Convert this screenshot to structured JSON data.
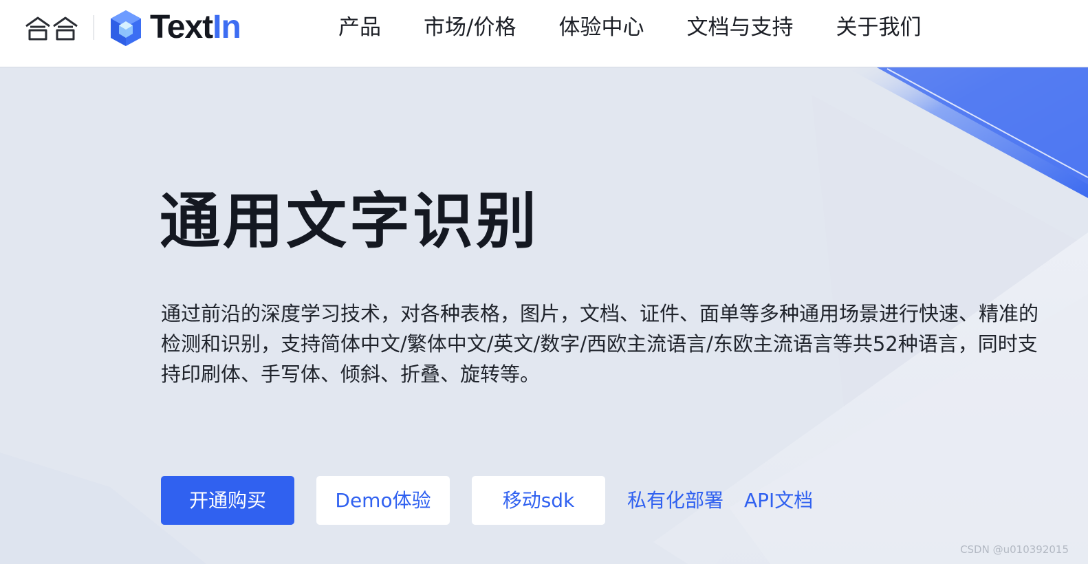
{
  "header": {
    "brand_hehe": "合合",
    "textin_text": "Text",
    "textin_in": "In",
    "nav": [
      "产品",
      "市场/价格",
      "体验中心",
      "文档与支持",
      "关于我们"
    ]
  },
  "hero": {
    "title": "通用文字识别",
    "description": "通过前沿的深度学习技术，对各种表格，图片，文档、证件、面单等多种通用场景进行快速、精准的检测和识别，支持简体中文/繁体中文/英文/数字/西欧主流语言/东欧主流语言等共52种语言，同时支持印刷体、手写体、倾斜、折叠、旋转等。",
    "buttons": {
      "buy": "开通购买",
      "demo": "Demo体验",
      "sdk": "移动sdk"
    },
    "links": {
      "private": "私有化部署",
      "api": "API文档"
    }
  },
  "watermark": "CSDN @u010392015",
  "colors": {
    "accent": "#3061f0",
    "background": "#e2e7f0",
    "title": "#141821"
  }
}
